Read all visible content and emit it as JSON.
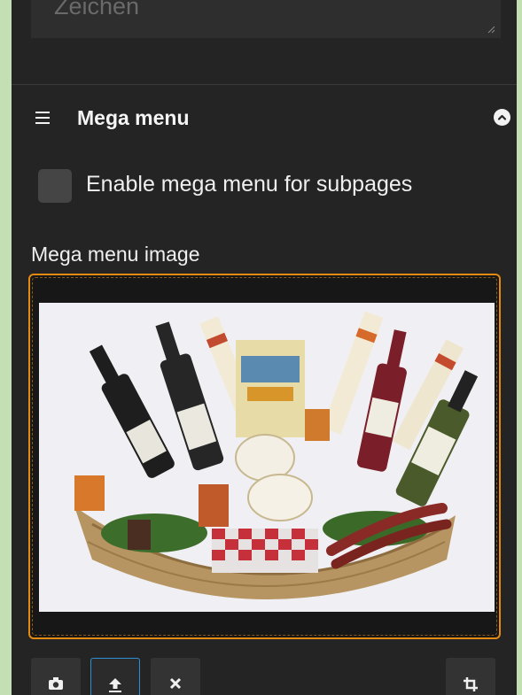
{
  "description": {
    "placeholder": "Zeichen"
  },
  "mega_menu": {
    "title": "Mega menu",
    "enable_label": "Enable mega menu for subpages",
    "enabled": false,
    "image_label": "Mega menu image"
  },
  "toolbar": {
    "buttons": [
      "camera-icon",
      "upload-icon",
      "remove-icon",
      "crop-icon"
    ]
  },
  "colors": {
    "panel": "#242424",
    "accent_focus": "#e38a12",
    "active_button": "#2f8fd6",
    "page_background": "#c5dfb4"
  }
}
